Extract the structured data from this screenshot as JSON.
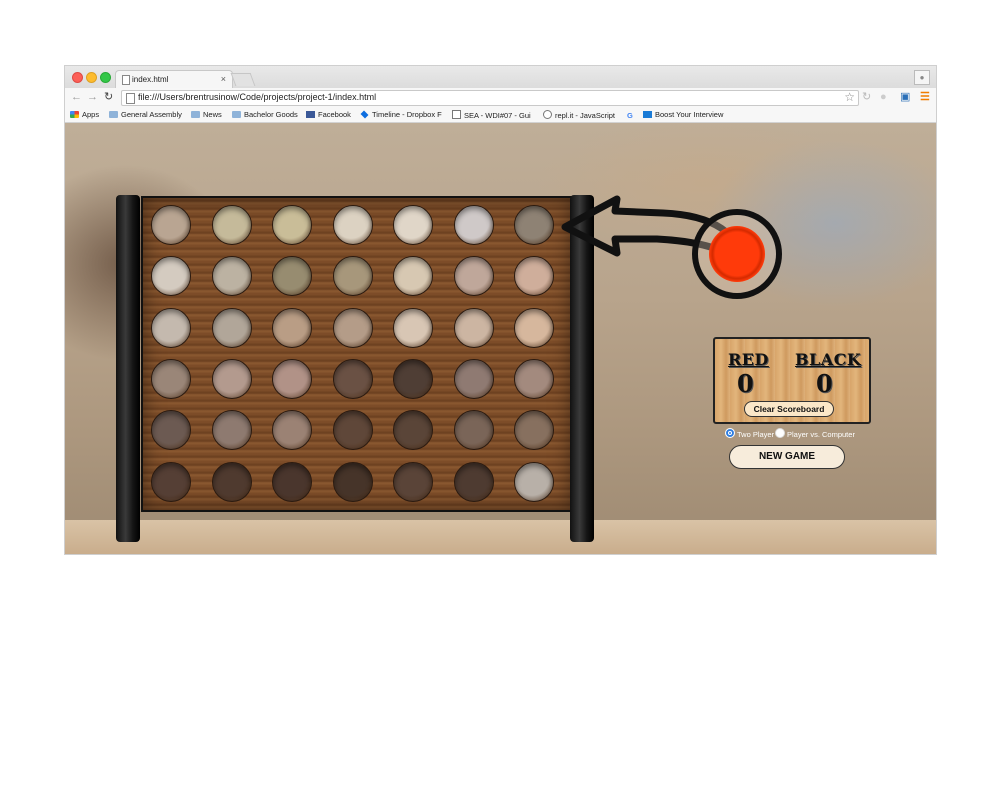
{
  "browser": {
    "tab_title": "index.html",
    "tab_close": "×",
    "url": "file:///Users/brentrusinow/Code/projects/project-1/index.html",
    "bookmarks": [
      {
        "label": "Apps",
        "icon": "apps-grid-icon"
      },
      {
        "label": "General Assembly",
        "icon": "folder-icon"
      },
      {
        "label": "News",
        "icon": "folder-icon"
      },
      {
        "label": "Bachelor Goods",
        "icon": "folder-icon"
      },
      {
        "label": "Facebook",
        "icon": "facebook-icon"
      },
      {
        "label": "Timeline - Dropbox F",
        "icon": "dropbox-icon"
      },
      {
        "label": "SEA - WDI#07 - Gui",
        "icon": "page-icon"
      },
      {
        "label": "repl.it - JavaScript",
        "icon": "page-icon"
      },
      {
        "label": "",
        "icon": "google-icon"
      },
      {
        "label": "Boost Your Interview",
        "icon": "bookmark-icon"
      }
    ]
  },
  "game": {
    "current_player": "red",
    "current_player_color": "#ff3a0a",
    "scoreboard": {
      "red_label": "RED",
      "black_label": "BLACK",
      "red_score": "0",
      "black_score": "0",
      "clear_label": "Clear Scoreboard"
    },
    "modes": {
      "two_player": "Two Player",
      "vs_computer": "Player vs. Computer",
      "selected": "two_player"
    },
    "new_game_label": "NEW GAME",
    "board": {
      "columns": 7,
      "rows": 6,
      "cells": [
        [
          "#b9a592",
          "#c5ba9a",
          "#c9bd98",
          "#dcd2c2",
          "#e0d6c8",
          "#cfc9c8",
          "#8e8274"
        ],
        [
          "#d4cbc0",
          "#bcb2a2",
          "#978c70",
          "#a7977b",
          "#d7c8b2",
          "#bfa79a",
          "#cfae9b"
        ],
        [
          "#c4b9ae",
          "#b1a699",
          "#b99d85",
          "#b49c88",
          "#d8c6b4",
          "#ccb5a2",
          "#d6b79d"
        ],
        [
          "#9a8678",
          "#b39a8e",
          "#b19287",
          "#6a5144",
          "#4f3e35",
          "#8f7a72",
          "#a38a7e"
        ],
        [
          "#6c5a52",
          "#8e7a70",
          "#9b8274",
          "#5f4739",
          "#5a4538",
          "#7a6558",
          "#87705f"
        ],
        [
          "#553f35",
          "#4f3a2f",
          "#4a362d",
          "#463429",
          "#5a4438",
          "#4e3b31",
          "#b8b0a8"
        ]
      ]
    }
  }
}
